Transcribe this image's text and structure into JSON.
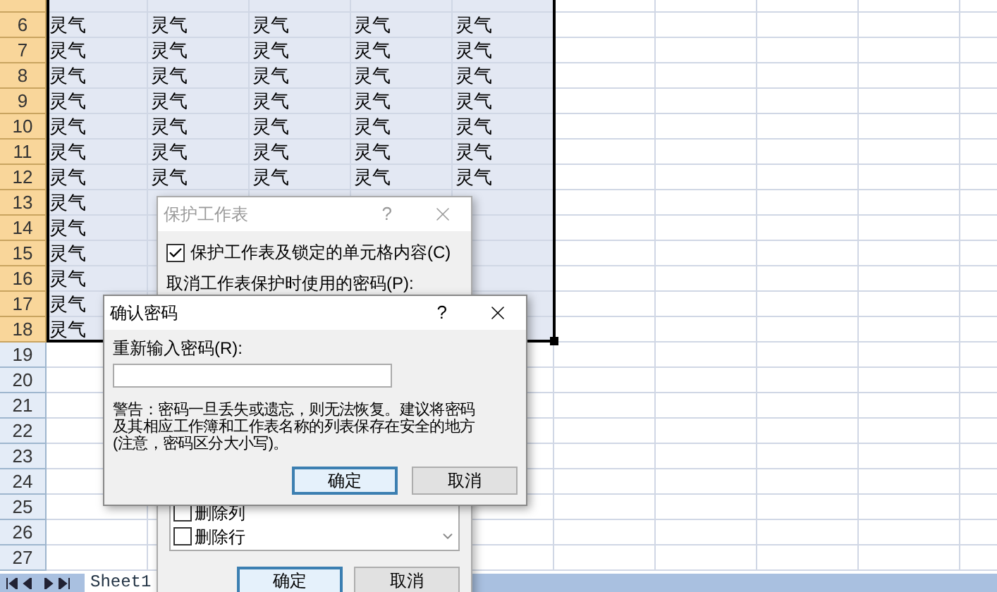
{
  "sheet": {
    "rows": [
      {
        "partial": true,
        "selected": true,
        "cells": []
      },
      {
        "header": "6",
        "selected": true,
        "cells": [
          "灵气",
          "灵气",
          "灵气",
          "灵气",
          "灵气"
        ]
      },
      {
        "header": "7",
        "selected": true,
        "cells": [
          "灵气",
          "灵气",
          "灵气",
          "灵气",
          "灵气"
        ]
      },
      {
        "header": "8",
        "selected": true,
        "cells": [
          "灵气",
          "灵气",
          "灵气",
          "灵气",
          "灵气"
        ]
      },
      {
        "header": "9",
        "selected": true,
        "cells": [
          "灵气",
          "灵气",
          "灵气",
          "灵气",
          "灵气"
        ]
      },
      {
        "header": "10",
        "selected": true,
        "cells": [
          "灵气",
          "灵气",
          "灵气",
          "灵气",
          "灵气"
        ]
      },
      {
        "header": "11",
        "selected": true,
        "cells": [
          "灵气",
          "灵气",
          "灵气",
          "灵气",
          "灵气"
        ]
      },
      {
        "header": "12",
        "selected": true,
        "cells": [
          "灵气",
          "灵气",
          "灵气",
          "灵气",
          "灵气"
        ]
      },
      {
        "header": "13",
        "selected": true,
        "cells": [
          "灵气"
        ]
      },
      {
        "header": "14",
        "selected": true,
        "cells": [
          "灵气"
        ]
      },
      {
        "header": "15",
        "selected": true,
        "cells": [
          "灵气"
        ]
      },
      {
        "header": "16",
        "selected": true,
        "cells": [
          "灵气"
        ]
      },
      {
        "header": "17",
        "selected": true,
        "cells": [
          "灵气"
        ]
      },
      {
        "header": "18",
        "selected": true,
        "cells": [
          "灵气"
        ]
      },
      {
        "header": "19",
        "selected": false,
        "cells": []
      },
      {
        "header": "20",
        "selected": false,
        "cells": []
      },
      {
        "header": "21",
        "selected": false,
        "cells": []
      },
      {
        "header": "22",
        "selected": false,
        "cells": []
      },
      {
        "header": "23",
        "selected": false,
        "cells": []
      },
      {
        "header": "24",
        "selected": false,
        "cells": []
      },
      {
        "header": "25",
        "selected": false,
        "cells": []
      },
      {
        "header": "26",
        "selected": false,
        "cells": []
      },
      {
        "header": "27",
        "selected": false,
        "cells": []
      }
    ]
  },
  "sheet_tabs": [
    {
      "label": "Sheet1",
      "selected": true
    }
  ],
  "protect_dialog": {
    "title": "保护工作表",
    "active": false,
    "help": "?",
    "protect_option": {
      "label": "保护工作表及锁定的单元格内容(C)",
      "checked": true
    },
    "password_label": "取消工作表保护时使用的密码(P):",
    "permissions": [
      {
        "label": "删除列",
        "checked": false
      },
      {
        "label": "删除行",
        "checked": false
      }
    ],
    "buttons": [
      {
        "label": "确定",
        "default": true
      },
      {
        "label": "取消",
        "default": false
      }
    ]
  },
  "confirm_dialog": {
    "title": "确认密码",
    "active": true,
    "help": "?",
    "field_label": "重新输入密码(R):",
    "warning_lines": [
      "警告：密码一旦丢失或遗忘，则无法恢复。建议将密码",
      "及其相应工作簿和工作表名称的列表保存在安全的地方",
      "(注意，密码区分大小写)。"
    ],
    "buttons": [
      {
        "label": "确定",
        "default": true
      },
      {
        "label": "取消",
        "default": false
      }
    ]
  }
}
